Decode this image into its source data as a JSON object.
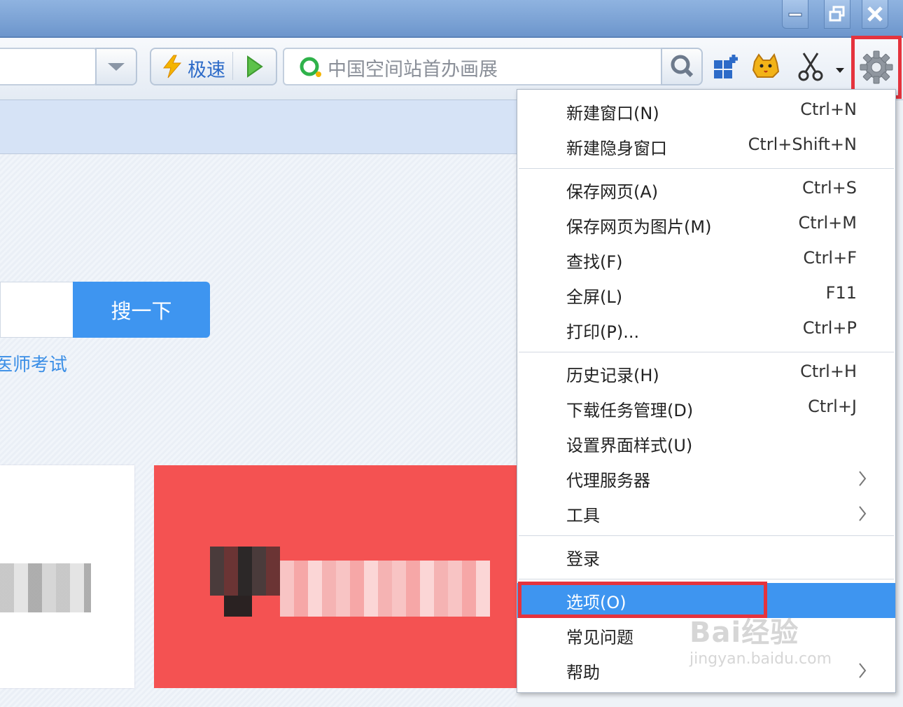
{
  "toolbar": {
    "speed_label": "极速",
    "address_text": "中国空间站首办画展"
  },
  "page": {
    "search_button": "搜一下",
    "hot_link": "医师考试"
  },
  "menu": {
    "items": [
      {
        "label": "新建窗口(N)",
        "shortcut": "Ctrl+N"
      },
      {
        "label": "新建隐身窗口",
        "shortcut": "Ctrl+Shift+N"
      },
      {
        "label": "保存网页(A)",
        "shortcut": "Ctrl+S"
      },
      {
        "label": "保存网页为图片(M)",
        "shortcut": "Ctrl+M"
      },
      {
        "label": "查找(F)",
        "shortcut": "Ctrl+F"
      },
      {
        "label": "全屏(L)",
        "shortcut": "F11"
      },
      {
        "label": "打印(P)...",
        "shortcut": "Ctrl+P"
      },
      {
        "label": "历史记录(H)",
        "shortcut": "Ctrl+H"
      },
      {
        "label": "下载任务管理(D)",
        "shortcut": "Ctrl+J"
      },
      {
        "label": "设置界面样式(U)",
        "shortcut": ""
      },
      {
        "label": "代理服务器",
        "shortcut": ""
      },
      {
        "label": "工具",
        "shortcut": ""
      },
      {
        "label": "登录",
        "shortcut": ""
      },
      {
        "label": "选项(O)",
        "shortcut": ""
      },
      {
        "label": "常见问题",
        "shortcut": ""
      },
      {
        "label": "帮助",
        "shortcut": ""
      }
    ],
    "highlighted": "选项(O)"
  },
  "watermark": {
    "brand": "Bai经验",
    "url": "jingyan.baidu.com"
  },
  "colors": {
    "accent": "#3e95f0",
    "highlight_box": "#e5333d",
    "promo_card": "#f45252"
  }
}
